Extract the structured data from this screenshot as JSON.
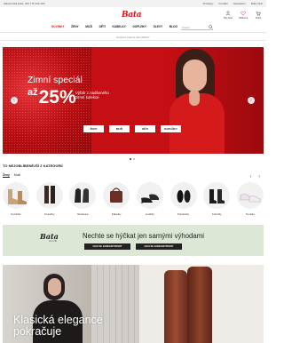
{
  "topbar": {
    "promo": "Zákaznická linka: 420 770 100 100",
    "links": [
      "Prodejny",
      "Kontakt",
      "Newsletter",
      "Bata Club"
    ]
  },
  "header": {
    "logo": "Bata",
    "icons": [
      {
        "name": "user-icon",
        "label": "Můj účet"
      },
      {
        "name": "heart-icon",
        "label": "Oblíbené"
      },
      {
        "name": "cart-icon",
        "label": "Košík"
      }
    ]
  },
  "nav": {
    "items": [
      "NOVINKY",
      "ŽENY",
      "MUŽI",
      "DĚTI",
      "KABELKY",
      "DOPLŇKY",
      "SLEVY",
      "BLOG"
    ],
    "active_index": 0,
    "search_placeholder": "Hledat"
  },
  "subbar": {
    "text": "Doprava zdarma nad 1499 Kč"
  },
  "hero": {
    "title": "Zimní speciál",
    "prefix": "až",
    "percent": "25%",
    "subtitle": "Výběr z nadšeného zimní kolekce",
    "buttons": [
      "ŽENY",
      "MUŽI",
      "DĚTI",
      "DOPLŇKY"
    ],
    "slide_count": 2,
    "active_slide": 0
  },
  "categories": {
    "heading": "TO NEJOBLÍBENĚJŠÍ Z KATEGORIÍ",
    "tabs": [
      "Ženy",
      "Muži"
    ],
    "active_tab": 0,
    "items": [
      {
        "label": "Kotníčky",
        "icon": "ankle-boot-icon"
      },
      {
        "label": "Kozačky",
        "icon": "tall-boot-icon"
      },
      {
        "label": "Rukavice",
        "icon": "gloves-icon"
      },
      {
        "label": "Kabelky",
        "icon": "handbag-icon"
      },
      {
        "label": "Lodičky",
        "icon": "pump-icon"
      },
      {
        "label": "Polobotky",
        "icon": "shoe-icon"
      },
      {
        "label": "Kotníkly",
        "icon": "chelsea-boot-icon"
      },
      {
        "label": "Tenisky",
        "icon": "sneaker-icon"
      }
    ]
  },
  "club": {
    "logo": "Bata",
    "logo_sub": "CLUB",
    "text": "Nechte se hýčkat jen samými výhodami",
    "buttons": [
      "CHCI SE ZAREGISTROVAT",
      "CHCI SE ZAREGISTROVAT"
    ]
  },
  "promo": {
    "title": "Klasická elegance pokračuje"
  }
}
